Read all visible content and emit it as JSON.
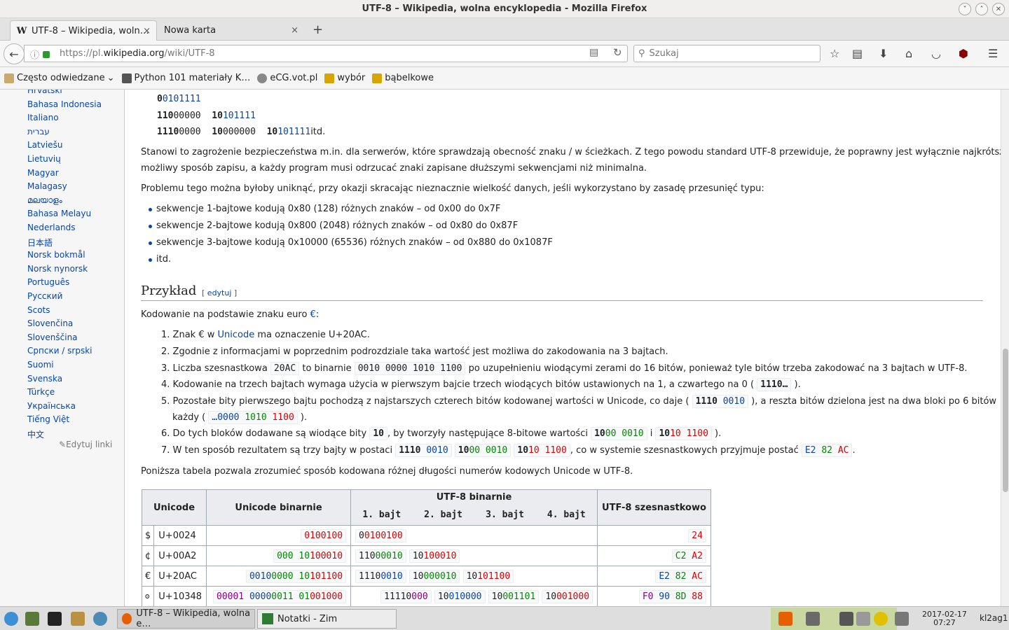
{
  "window": {
    "title": "UTF-8 – Wikipedia, wolna encyklopedia - Mozilla Firefox"
  },
  "tabs": [
    {
      "label": "UTF-8 – Wikipedia, woln…",
      "close": "×"
    },
    {
      "label": "Nowa karta",
      "close": "×"
    }
  ],
  "new_tab": "+",
  "nav": {
    "url_prefix": "https://pl.",
    "url_domain": "wikipedia.org",
    "url_path": "/wiki/UTF-8",
    "search_placeholder": "Szukaj"
  },
  "bookmarks": [
    {
      "label": "Często odwiedzane",
      "color": "#c9a96e"
    },
    {
      "label": "Python 101 materiały K…",
      "color": "#555555"
    },
    {
      "label": "eCG.vot.pl",
      "color": "#888888"
    },
    {
      "label": "wybór",
      "color": "#d8a400"
    },
    {
      "label": "bąbelkowe",
      "color": "#d8a400"
    }
  ],
  "sidebar": {
    "languages": [
      "Hrvatski",
      "Bahasa Indonesia",
      "Italiano",
      "עברית",
      "Latviešu",
      "Lietuvių",
      "Magyar",
      "Malagasy",
      "മലയാളം",
      "Bahasa Melayu",
      "Nederlands",
      "日本語",
      "Norsk bokmål",
      "Norsk nynorsk",
      "Português",
      "Русский",
      "Scots",
      "Slovenčina",
      "Slovenščina",
      "Српски / srpski",
      "Suomi",
      "Svenska",
      "Türkçe",
      "Українська",
      "Tiếng Việt",
      "中文"
    ],
    "edit_links": "Edytuj linki"
  },
  "article": {
    "enc1_a": "0",
    "enc1_b": "0101111",
    "enc2": {
      "a1": "110",
      "a2": "00000",
      "b1": "10",
      "b2": "101111"
    },
    "enc3": {
      "a1": "1110",
      "a2": "0000",
      "b1": "10",
      "b2": "000000",
      "c1": "10",
      "c2": "101111",
      "suffix": "itd."
    },
    "para1_line1": "Stanowi to zagrożenie bezpieczeństwa m.in. dla serwerów, które sprawdzają obecność znaku / w ścieżkach. Z tego powodu standard UTF-8 przewiduje, że poprawny jest wyłącznie najkrótszy",
    "para1_line2": "możliwy sposób zapisu, a każdy program musi odrzucać znaki zapisane dłuższymi sekwencjami niż minimalna.",
    "para2": "Problemu tego można byłoby uniknąć, przy okazji skracając nieznacznie wielkość danych, jeśli wykorzystano by zasadę przesunięć typu:",
    "bullets": [
      "sekwencje 1-bajtowe kodują 0x80 (128) różnych znaków – od 0x00 do 0x7F",
      "sekwencje 2-bajtowe kodują 0x800 (2048) różnych znaków – od 0x80 do 0x87F",
      "sekwencje 3-bajtowe kodują 0x10000 (65536) różnych znaków – od 0x880 do 0x1087F",
      "itd."
    ],
    "heading": "Przykład",
    "edit_section": "edytuj",
    "intro_prefix": "Kodowanie na podstawie znaku euro ",
    "intro_euro": "€",
    "intro_suffix": ":",
    "steps": {
      "s1_num": "1.",
      "s1_a": "Znak € w ",
      "s1_link": "Unicode",
      "s1_b": " ma oznaczenie U+20AC.",
      "s2_num": "2.",
      "s2": "Zgodnie z informacjami w poprzednim podrozdziale taka wartość jest możliwa do zakodowania na 3 bajtach.",
      "s3_num": "3.",
      "s3_a": "Liczba szesnastkowa ",
      "s3_code1": "20AC",
      "s3_b": " to binarnie ",
      "s3_code2": "0010 0000 1010 1100",
      "s3_c": " po uzupełnieniu wiodącymi zerami do 16 bitów, ponieważ tyle bitów trzeba zakodować na 3 bajtach w UTF-8.",
      "s4_num": "4.",
      "s4_a": "Kodowanie na trzech bajtach wymaga użycia w pierwszym bajcie trzech wiodących bitów ustawionych na 1, a czwartego na 0 ( ",
      "s4_code": "1110…",
      "s4_b": " ).",
      "s5_num": "5.",
      "s5_a": "Pozostałe bity pierwszego bajtu pochodzą z najstarszych czterech bitów kodowanej wartości w Unicode, co daje ( ",
      "s5_code_a": "1110",
      "s5_code_b": " 0010",
      "s5_b": " ), a reszta bitów dzielona jest na dwa bloki po 6 bitów",
      "s5_line2_a": "każdy ( ",
      "s5_l2_c1": "…0000",
      "s5_l2_c2": " 1010",
      "s5_l2_c3": " 1100",
      "s5_line2_b": " ).",
      "s6_num": "6.",
      "s6_a": "Do tych bloków dodawane są wiodące bity ",
      "s6_code": "10",
      "s6_b": ", by tworzyły następujące 8-bitowe wartości ",
      "s6_c1a": "10",
      "s6_c1b": "00",
      "s6_c1c": " 0010",
      "s6_mid": " i ",
      "s6_c2a": "10",
      "s6_c2b": "10",
      "s6_c2c": " 1100",
      "s6_end": " ).",
      "s7_num": "7.",
      "s7_a": "W ten sposób rezultatem są trzy bajty w postaci ",
      "s7_b1a": "1110",
      "s7_b1b": " 0010",
      "s7_b2a": "10",
      "s7_b2b": "00",
      "s7_b2c": " 0010",
      "s7_b3a": "10",
      "s7_b3b": "10",
      "s7_b3c": " 1100",
      "s7_c": ", co w systemie szesnastkowych przyjmuje postać ",
      "s7_h1": "E2",
      "s7_h2": " 82",
      "s7_h3": " AC",
      "s7_d": "."
    },
    "table_intro": "Poniższa tabela pozwala zrozumieć sposób kodowana różnej długości numerów kodowych Unicode w UTF-8.",
    "table": {
      "h_unicode": "Unicode",
      "h_binary": "Unicode binarnie",
      "h_utf8bin": "UTF-8 binarnie",
      "h_bytes": [
        "1. bajt",
        "2. bajt",
        "3. bajt",
        "4. bajt"
      ],
      "h_hex": "UTF-8 szesnastkowo",
      "rows": [
        {
          "char": "$",
          "code": "U+0024"
        },
        {
          "char": "¢",
          "code": "U+00A2"
        },
        {
          "char": "€",
          "code": "U+20AC"
        },
        {
          "char": "𐍈",
          "code": "U+10348"
        }
      ],
      "r0_bin": "0100100",
      "r0_b1a": "0",
      "r0_b1b": "0100100",
      "r0_hex": "24",
      "r1_bin_a": "000",
      "r1_bin_b": " 10",
      "r1_bin_c": "100010",
      "r1_b1a": "110",
      "r1_b1b": "00010",
      "r1_b2a": "10",
      "r1_b2b": "100010",
      "r1_hex1": "C2",
      "r1_hex2": " A2",
      "r2_bin_a": "0010",
      "r2_bin_b": "0000",
      "r2_bin_c": " 10",
      "r2_bin_d": "101100",
      "r2_b1a": "1110",
      "r2_b1b": "0010",
      "r2_b2a": "10",
      "r2_b2b": "000010",
      "r2_b3a": "10",
      "r2_b3b": "101100",
      "r2_hex1": "E2",
      "r2_hex2": " 82",
      "r2_hex3": " AC",
      "r3_bin_a": "00001",
      "r3_bin_b": " 0000",
      "r3_bin_c": "0011",
      "r3_bin_d": " 01",
      "r3_bin_e": "001000",
      "r3_b1a": "11110",
      "r3_b1b": "000",
      "r3_b2a": "10",
      "r3_b2b": "010000",
      "r3_b3a": "10",
      "r3_b3b": "001101",
      "r3_b4a": "10",
      "r3_b4b": "001000",
      "r3_hex1": "F0",
      "r3_hex2": " 90",
      "r3_hex3": " 8D",
      "r3_hex4": " 88"
    }
  },
  "taskbar": {
    "tasks": [
      "UTF-8 – Wikipedia, wolna e…",
      "Notatki - Zim"
    ],
    "date": "2017-02-17",
    "time": "07:27",
    "user": "kl2ag1"
  }
}
